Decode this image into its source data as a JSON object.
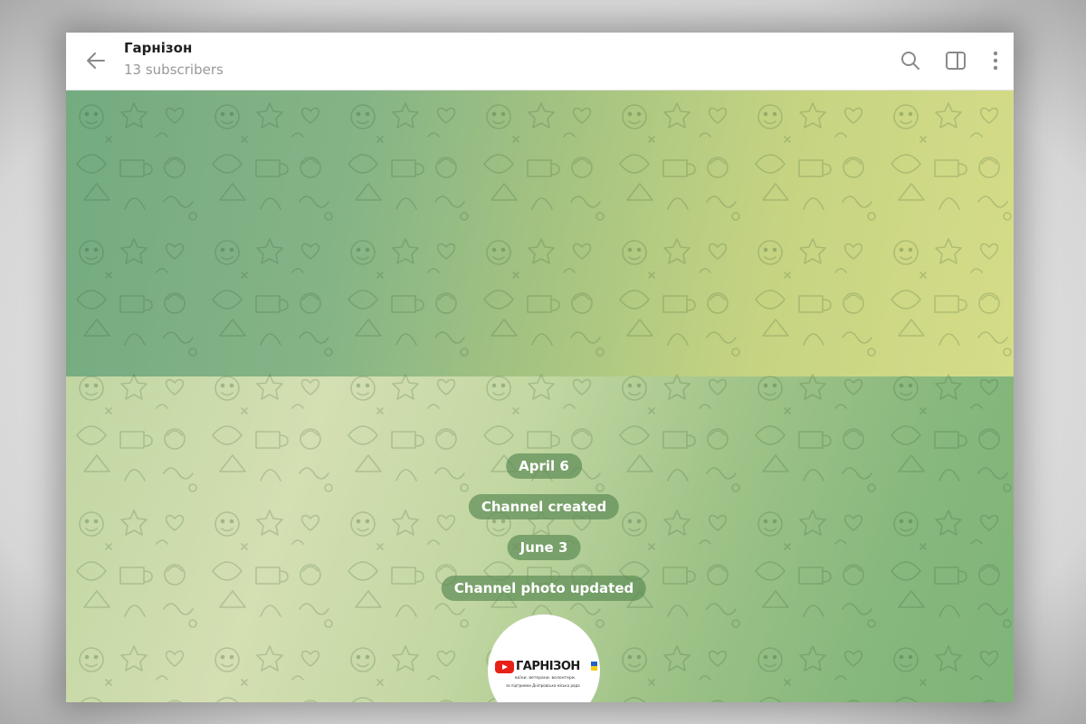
{
  "header": {
    "title": "Гарнізон",
    "subtitle": "13 subscribers",
    "icons": [
      "back-arrow-icon",
      "search-icon",
      "sidebar-toggle-icon",
      "more-vertical-icon"
    ]
  },
  "messages": {
    "date_1": "April 6",
    "service_1": "Channel created",
    "date_2": "June 3",
    "service_2": "Channel photo updated"
  },
  "channel_photo": {
    "brand_name": "ГАРНІЗОН",
    "tagline": "воїни. ветерани. волонтери.",
    "support_line": "за підтримки  Дніпровська міська рада",
    "play_icon": "youtube-play-icon",
    "flag_icon": "ukraine-flag-icon"
  },
  "colors": {
    "accent": "#5c8c55",
    "header_bg": "#ffffff",
    "subtitle": "#999999",
    "icon": "#888888"
  }
}
